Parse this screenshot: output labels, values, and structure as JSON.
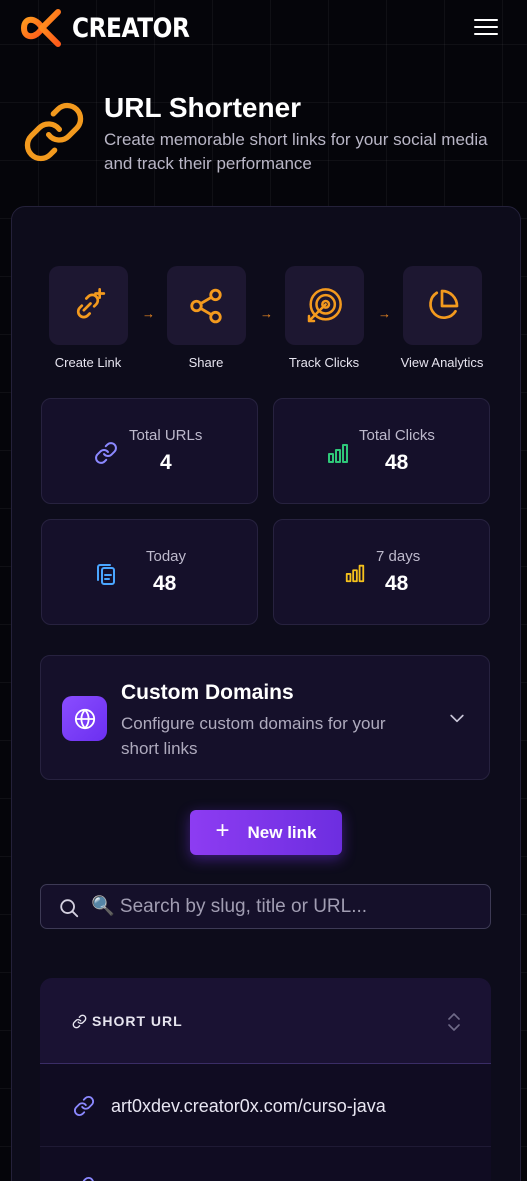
{
  "header": {
    "brand": "CREATOR"
  },
  "hero": {
    "title": "URL Shortener",
    "subtitle": "Create memorable short links for your social media and track their performance"
  },
  "steps": [
    {
      "label": "Create Link",
      "icon": "link-plus-icon"
    },
    {
      "label": "Share",
      "icon": "share-icon"
    },
    {
      "label": "Track Clicks",
      "icon": "target-icon"
    },
    {
      "label": "View Analytics",
      "icon": "pie-chart-icon"
    }
  ],
  "stats": {
    "total_urls": {
      "label": "Total URLs",
      "value": "4"
    },
    "total_clicks": {
      "label": "Total Clicks",
      "value": "48"
    },
    "today": {
      "label": "Today",
      "value": "48"
    },
    "seven_days": {
      "label": "7 days",
      "value": "48"
    }
  },
  "domains": {
    "title": "Custom Domains",
    "description": "Configure custom domains for your short links"
  },
  "actions": {
    "new_link": "New link"
  },
  "search": {
    "placeholder": "🔍 Search by slug, title or URL..."
  },
  "table": {
    "column": "SHORT URL",
    "rows": [
      "art0xdev.creator0x.com/curso-java"
    ]
  },
  "colors": {
    "accent": "#8d3cf2",
    "brand_orange": "#f08a22",
    "background": "#05050a"
  }
}
